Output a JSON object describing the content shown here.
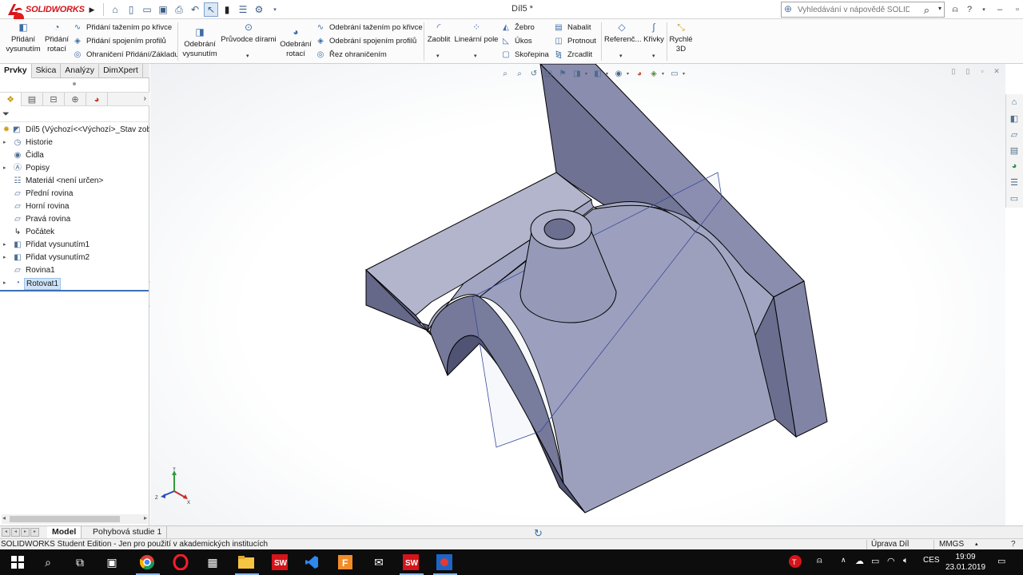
{
  "app": {
    "logo_text": "SOLIDWORKS",
    "window_title": "Díl5 *",
    "help_search_placeholder": "Vyhledávání v nápovědě SOLIDWORKS"
  },
  "ribbon": {
    "extrude_boss": "Přidání vysunutím",
    "revolve_boss": "Přidání rotací",
    "swept_boss": "Přidání tažením po křivce",
    "lofted_boss": "Přidání spojením profilů",
    "boundary_boss": "Ohraničení Přidání/Základu",
    "extruded_cut": "Odebrání vysunutím",
    "hole_wizard": "Průvodce dírami",
    "revolved_cut": "Odebrání rotací",
    "swept_cut": "Odebrání tažením po křivce",
    "lofted_cut": "Odebrání spojením profilů",
    "boundary_cut": "Řez ohraničením",
    "fillet": "Zaoblit",
    "linear_pattern": "Lineární pole",
    "rib": "Žebro",
    "draft": "Úkos",
    "shell": "Skořepina",
    "wrap": "Nabalit",
    "intersect": "Protnout",
    "mirror": "Zrcadlit",
    "reference": "Referenč...",
    "curves": "Křivky",
    "instant3d": "Rychlé 3D"
  },
  "command_manager_tabs": [
    "Prvky",
    "Skica",
    "Analýzy",
    "DimXpert"
  ],
  "feature_tree": {
    "root": "Díl5  (Výchozí<<Výchozí>_Stav zob",
    "items": [
      {
        "label": "Historie",
        "icon": "history-icon",
        "expandable": true
      },
      {
        "label": "Čidla",
        "icon": "sensor-icon",
        "expandable": false
      },
      {
        "label": "Popisy",
        "icon": "annotations-icon",
        "expandable": true
      },
      {
        "label": "Materiál <není určen>",
        "icon": "material-icon",
        "expandable": false
      },
      {
        "label": "Přední rovina",
        "icon": "plane-icon",
        "expandable": false
      },
      {
        "label": "Horní rovina",
        "icon": "plane-icon",
        "expandable": false
      },
      {
        "label": "Pravá rovina",
        "icon": "plane-icon",
        "expandable": false
      },
      {
        "label": "Počátek",
        "icon": "origin-icon",
        "expandable": false
      },
      {
        "label": "Přidat vysunutím1",
        "icon": "extrude-icon",
        "expandable": true
      },
      {
        "label": "Přidat vysunutím2",
        "icon": "extrude-icon",
        "expandable": true
      },
      {
        "label": "Rovina1",
        "icon": "plane-icon",
        "expandable": false
      },
      {
        "label": "Rotovat1",
        "icon": "revolve-icon",
        "expandable": true
      }
    ]
  },
  "bottom_tabs": [
    "Model",
    "Pohybová studie 1"
  ],
  "status": {
    "message": "SOLIDWORKS Student Edition - Jen pro použití v akademických institucích",
    "mode": "Úprava Díl",
    "units": "MMGS"
  },
  "taskbar": {
    "language": "CES",
    "time": "19:09",
    "date": "23.01.2019"
  },
  "colors": {
    "brand_red": "#d4141b",
    "model_face": "#9498b8",
    "accent_blue": "#3d6fb4"
  }
}
